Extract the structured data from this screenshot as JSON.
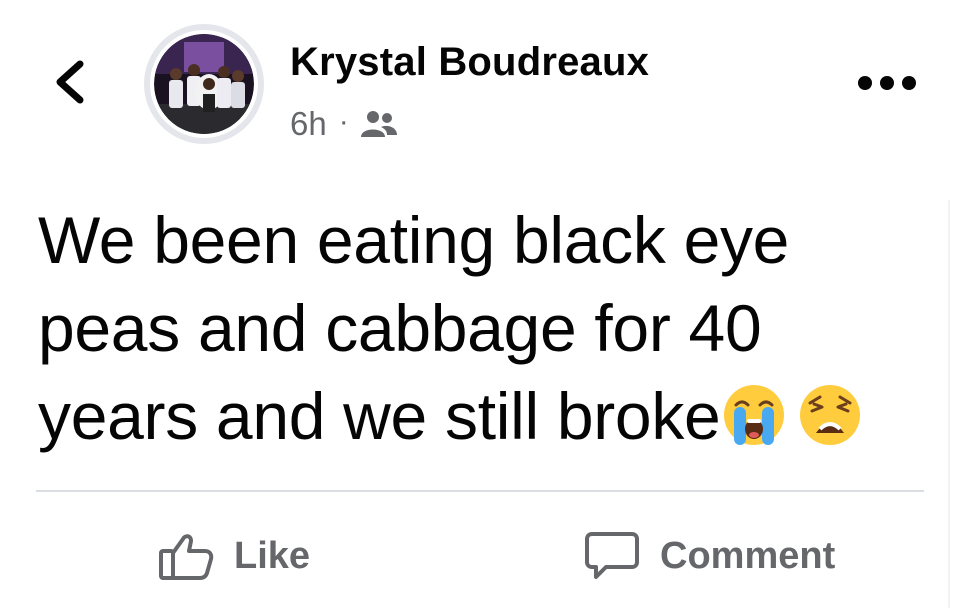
{
  "post": {
    "author_name": "Krystal Boudreaux",
    "time_ago": "6h",
    "separator": "·",
    "audience_icon": "friends-icon",
    "text": "We been eating black eye peas and cabbage for 40 years and we still broke",
    "emojis": [
      "loudly-crying-face",
      "weary-face"
    ]
  },
  "header": {
    "back_icon": "chevron-left-icon",
    "more_icon": "more-horizontal-icon"
  },
  "actions": {
    "like_label": "Like",
    "comment_label": "Comment"
  },
  "colors": {
    "text_primary": "#050505",
    "text_secondary": "#65676b",
    "divider": "#dadde1"
  }
}
